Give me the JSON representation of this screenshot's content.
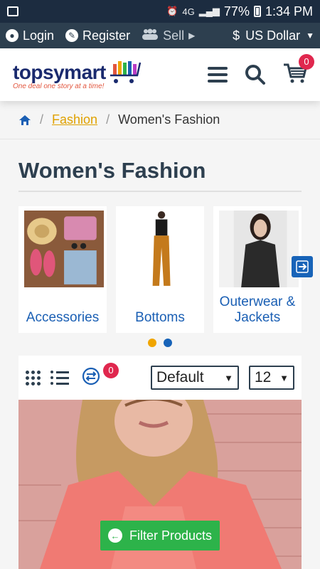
{
  "statusbar": {
    "battery": "77%",
    "time": "1:34 PM",
    "network": "4G"
  },
  "topbar": {
    "login": "Login",
    "register": "Register",
    "sell": "Sell",
    "currency": "US Dollar",
    "currency_symbol": "$"
  },
  "header": {
    "logo_name": "topsymart",
    "logo_tagline": "One deal one story at a time!",
    "cart_count": "0"
  },
  "breadcrumb": {
    "parent": "Fashion",
    "current": "Women's Fashion"
  },
  "page": {
    "title": "Women's Fashion"
  },
  "categories": [
    {
      "label": "Accessories"
    },
    {
      "label": "Bottoms"
    },
    {
      "label": "Outerwear & Jackets"
    }
  ],
  "carousel": {
    "dots": [
      "#f0a500",
      "#1763b8"
    ]
  },
  "toolbar": {
    "compare_count": "0",
    "sort_value": "Default",
    "per_page_value": "12"
  },
  "filter": {
    "label": "Filter Products"
  },
  "colors": {
    "navy": "#2d3f4f",
    "link_blue": "#1a5fb4",
    "badge_red": "#e0274e",
    "filter_green": "#2db34a"
  }
}
